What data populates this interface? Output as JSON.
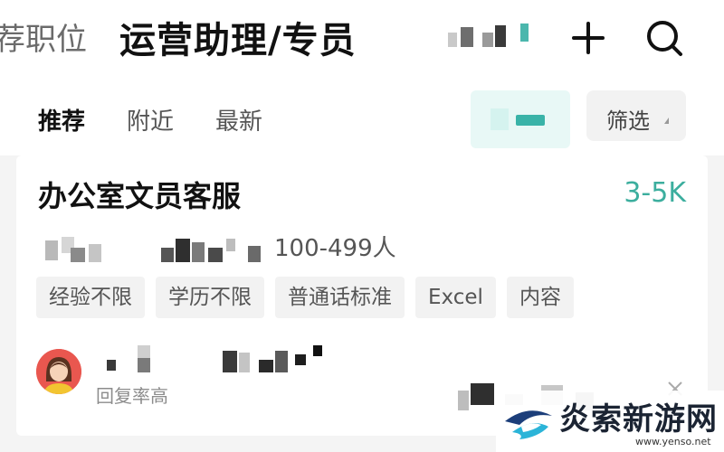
{
  "header": {
    "prev_tab": "荐职位",
    "title": "运营助理/专员",
    "add_icon": "plus-icon",
    "search_icon": "search-icon"
  },
  "filter_bar": {
    "tabs": [
      {
        "label": "推荐",
        "active": true
      },
      {
        "label": "附近",
        "active": false
      },
      {
        "label": "最新",
        "active": false
      }
    ],
    "filter_label": "筛选",
    "accent_color": "#39b3a8"
  },
  "job": {
    "title": "办公室文员客服",
    "salary": "3-5K",
    "company_size": "100-499人",
    "tags": [
      "经验不限",
      "学历不限",
      "普通话标准",
      "Excel",
      "内容"
    ],
    "recruiter_reply": "回复率高",
    "salary_color": "#3cae9e"
  },
  "watermark": {
    "text": "炎索新游网",
    "url": "www.yenso.net"
  }
}
